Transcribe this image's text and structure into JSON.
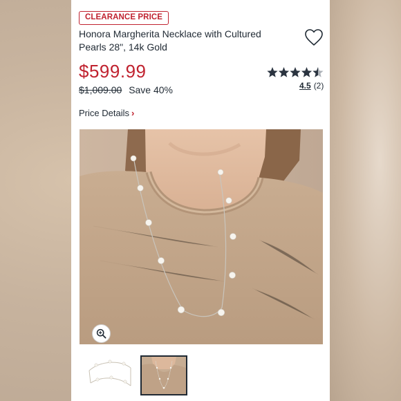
{
  "badge": "CLEARANCE PRICE",
  "product": {
    "title": "Honora Margherita Necklace with Cultured Pearls 28\", 14k Gold"
  },
  "pricing": {
    "price": "$599.99",
    "original_price": "$1,009.00",
    "savings": "Save 40%",
    "details_label": "Price Details",
    "details_chevron": "›"
  },
  "rating": {
    "value": "4.5",
    "count": "(2)",
    "stars": 4.5,
    "max": 5
  },
  "icons": {
    "favorite": "heart-icon",
    "zoom": "magnify-icon",
    "details": "chevron-right-icon"
  },
  "colors": {
    "accent": "#c0222f",
    "text": "#1f2933",
    "stars": "#2b3440"
  },
  "gallery": {
    "thumbnail_count": 2,
    "selected_index": 1
  }
}
